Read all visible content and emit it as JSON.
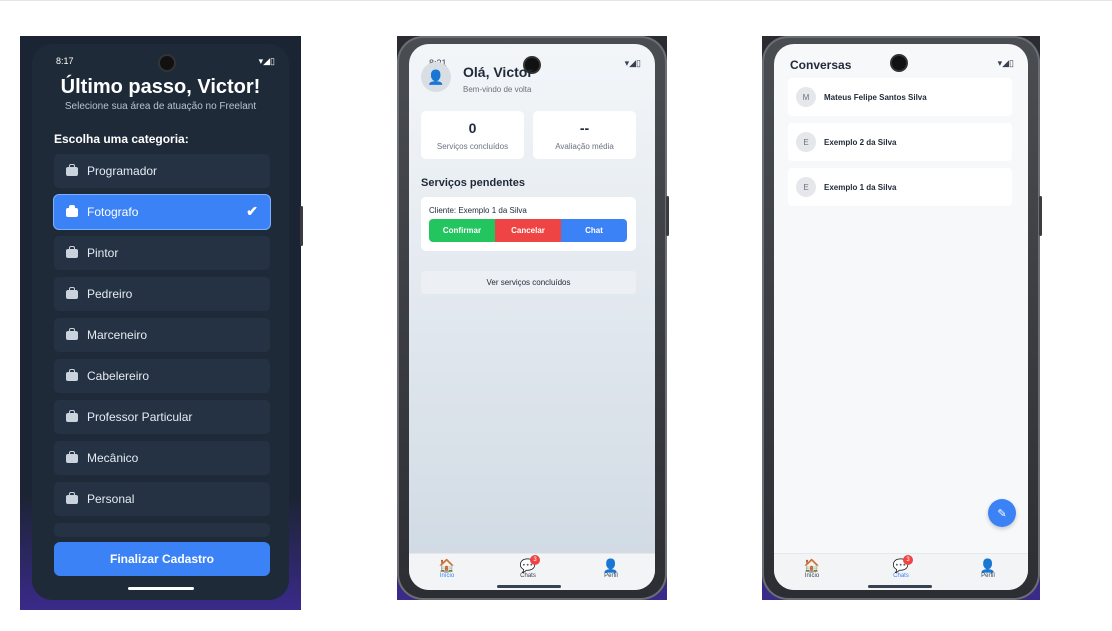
{
  "phone1": {
    "status_time": "8:17",
    "title": "Último passo, Victor!",
    "subtitle": "Selecione sua área de atuação no Freelant",
    "category_heading": "Escolha uma categoria:",
    "categories": [
      {
        "label": "Programador"
      },
      {
        "label": "Fotografo",
        "selected": true
      },
      {
        "label": "Pintor"
      },
      {
        "label": "Pedreiro"
      },
      {
        "label": "Marceneiro"
      },
      {
        "label": "Cabelereiro"
      },
      {
        "label": "Professor Particular"
      },
      {
        "label": "Mecânico"
      },
      {
        "label": "Personal"
      }
    ],
    "finish_button": "Finalizar Cadastro"
  },
  "phone2": {
    "status_time": "8:21",
    "greeting": "Olá, Victor",
    "welcome": "Bem-vindo de volta",
    "stats": [
      {
        "value": "0",
        "label": "Serviços concluídos"
      },
      {
        "value": "--",
        "label": "Avaliação média"
      }
    ],
    "pending_heading": "Serviços pendentes",
    "pending_client": "Cliente: Exemplo 1 da Silva",
    "actions": {
      "confirm": "Confirmar",
      "cancel": "Cancelar",
      "chat": "Chat"
    },
    "view_completed": "Ver serviços concluídos",
    "tabs": {
      "home": "Início",
      "chats": "Chats",
      "profile": "Perfil"
    },
    "chat_badge": "3"
  },
  "phone3": {
    "title": "Conversas",
    "conversations": [
      {
        "initial": "M",
        "name": "Mateus Felipe Santos Silva"
      },
      {
        "initial": "E",
        "name": "Exemplo 2 da Silva"
      },
      {
        "initial": "E",
        "name": "Exemplo 1 da Silva"
      }
    ],
    "tabs": {
      "home": "Início",
      "chats": "Chats",
      "profile": "Perfil"
    },
    "chat_badge": "3"
  },
  "colors": {
    "accent": "#3b82f6",
    "confirm": "#22c55e",
    "cancel": "#ef4444",
    "dark_bg": "#1e2a38"
  },
  "icons": [
    "briefcase-icon",
    "check-icon",
    "user-icon",
    "home-icon",
    "chat-icon",
    "pencil-icon"
  ]
}
